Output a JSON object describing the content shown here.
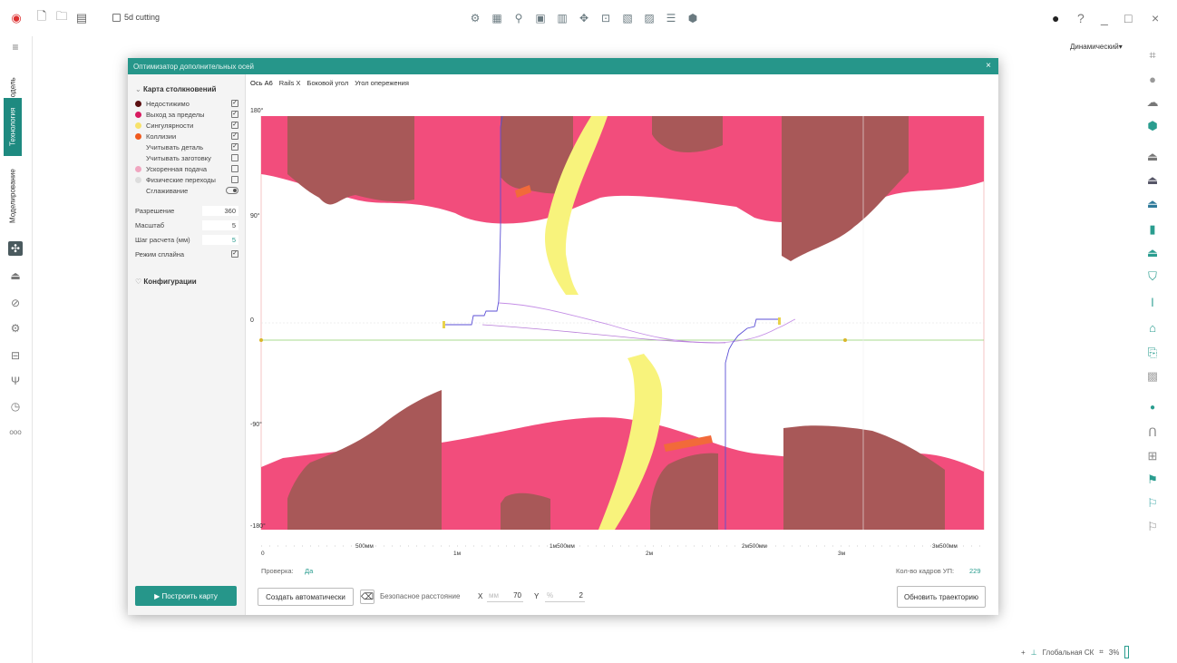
{
  "topbar": {
    "doc_title": "5d cutting",
    "window_controls": [
      "?",
      "_",
      "□",
      "×"
    ]
  },
  "leftbar": {
    "tabs": [
      "Модель",
      "Технология",
      "Моделирование"
    ]
  },
  "mode_dropdown": "Динамический",
  "status": {
    "coord_system": "Глобальная СК",
    "zoom": "3%"
  },
  "dialog": {
    "title": "Оптимизатор дополнительных осей",
    "close": "×",
    "section1": "Карта столкновений",
    "items": [
      {
        "label": "Недостижимо",
        "color": "#5a0f10",
        "checked": true
      },
      {
        "label": "Выход за пределы",
        "color": "#d81b60",
        "checked": true
      },
      {
        "label": "Сингулярности",
        "color": "#f7e26b",
        "checked": true
      },
      {
        "label": "Коллизии",
        "color": "#f05a1e",
        "checked": true
      },
      {
        "label": "Учитывать деталь",
        "color": "",
        "checked": true
      },
      {
        "label": "Учитывать заготовку",
        "color": "",
        "checked": false
      },
      {
        "label": "Ускоренная подача",
        "color": "#f0a6c0",
        "checked": false
      },
      {
        "label": "Физические переходы",
        "color": "#dddddd",
        "checked": false
      }
    ],
    "smoothing_label": "Сглаживание",
    "params": [
      {
        "label": "Разрешение",
        "value": "360"
      },
      {
        "label": "Масштаб",
        "value": "5"
      },
      {
        "label": "Шаг расчета (мм)",
        "value": "5"
      }
    ],
    "spline_label": "Режим сплайна",
    "section2": "Конфигурации",
    "build_button": "▶ Построить карту",
    "tabs": [
      "Ось A6",
      "Rails X",
      "Боковой угол",
      "Угол опережения"
    ],
    "y_ticks": [
      "180°",
      "90°",
      "0",
      "-90°",
      "-180°"
    ],
    "x_ticks": [
      "0",
      "500мм",
      "1м",
      "1м500мм",
      "2м",
      "2м500мм",
      "3м",
      "3м500мм"
    ],
    "check_label": "Проверка:",
    "check_value": "Да",
    "frames_label": "Кол-во кадров УП:",
    "frames_value": "229",
    "auto_button": "Создать автоматически",
    "safe_label": "Безопасное расстояние",
    "x_label": "X",
    "x_unit": "мм",
    "x_value": "70",
    "y_label": "Y",
    "y_unit": "%",
    "y_value": "2",
    "update_button": "Обновить траекторию"
  }
}
